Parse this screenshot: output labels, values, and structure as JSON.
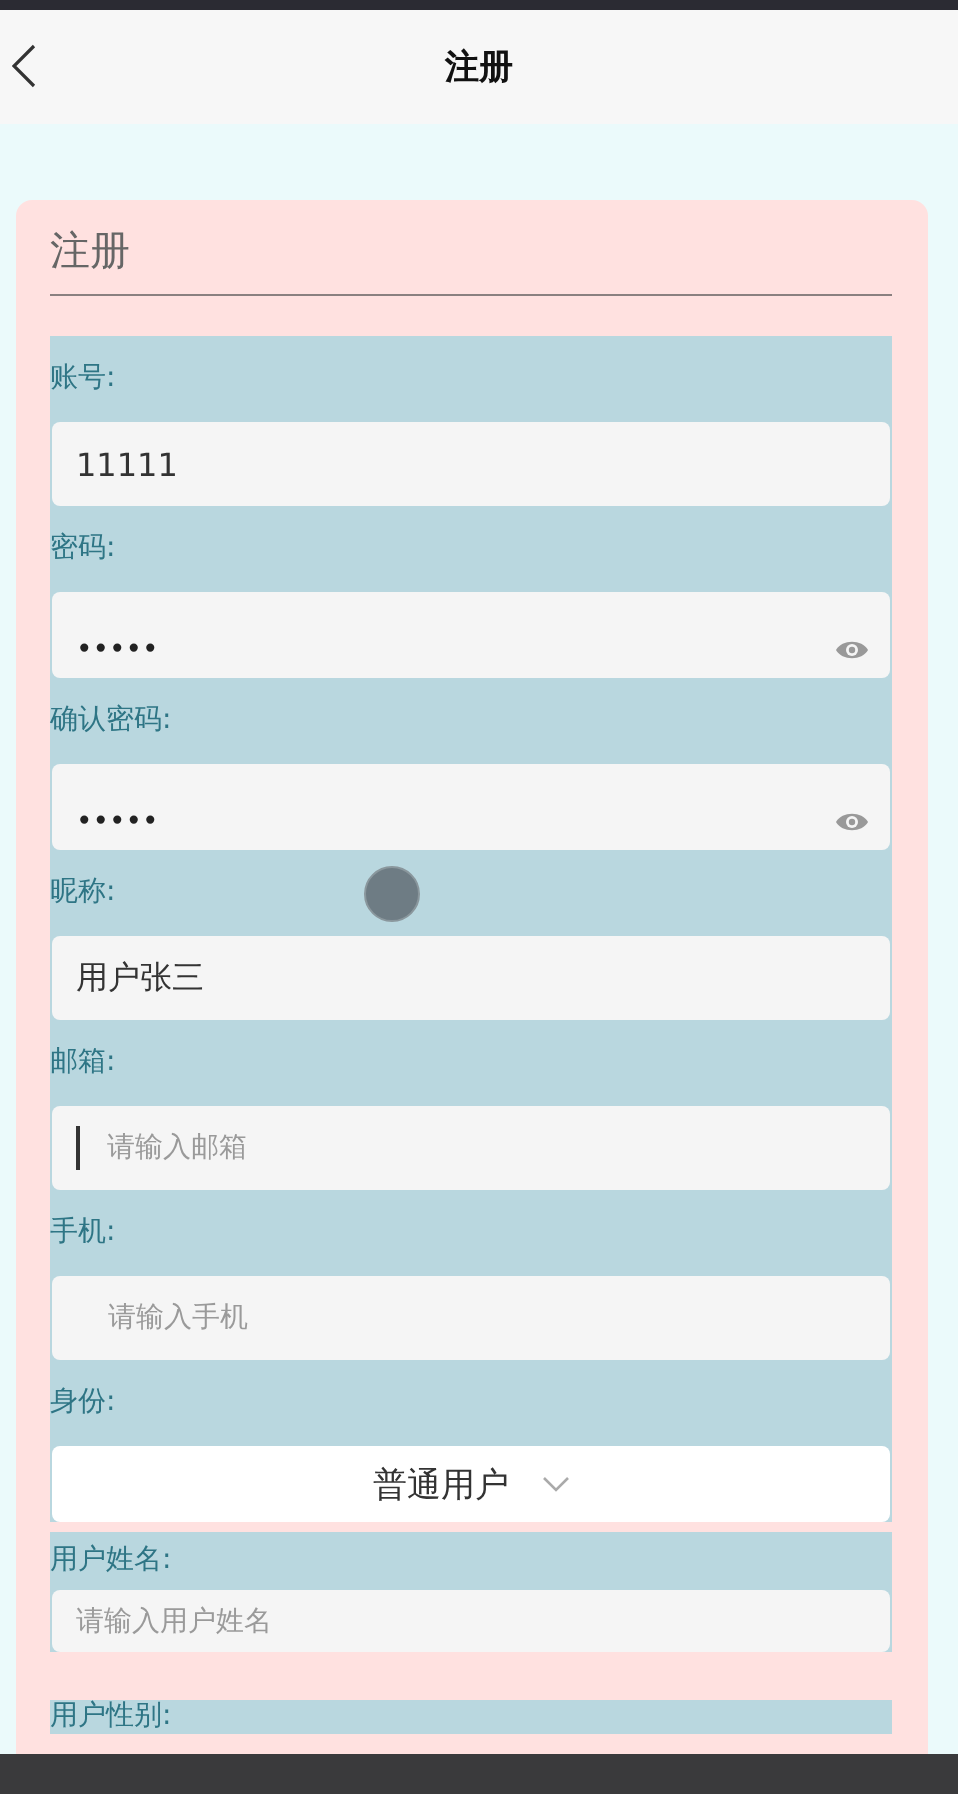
{
  "header": {
    "title": "注册"
  },
  "form": {
    "title": "注册",
    "fields": [
      {
        "kind": "text",
        "label": "账号:",
        "value": "11111"
      },
      {
        "kind": "password",
        "label": "密码:",
        "value": "•••••"
      },
      {
        "kind": "password",
        "label": "确认密码:",
        "value": "•••••"
      },
      {
        "kind": "text",
        "label": "昵称:",
        "value": "用户张三"
      },
      {
        "kind": "text",
        "label": "邮箱:",
        "placeholder": "请输入邮箱",
        "focused": true
      },
      {
        "kind": "text",
        "label": "手机:",
        "placeholder": "请输入手机"
      },
      {
        "kind": "select",
        "label": "身份:",
        "value": "普通用户"
      },
      {
        "kind": "compact",
        "label": "用户姓名:",
        "placeholder": "请输入用户姓名"
      },
      {
        "kind": "label_only",
        "label": "用户性别:"
      }
    ]
  }
}
